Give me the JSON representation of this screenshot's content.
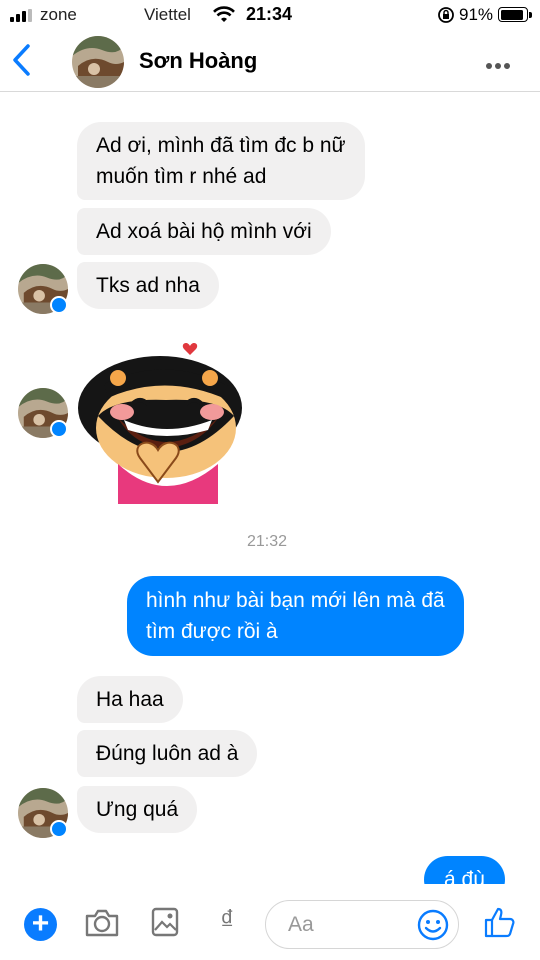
{
  "status_bar": {
    "carrier_left": "zone",
    "carrier": "Viettel",
    "time": "21:34",
    "battery": "91%",
    "battery_level": 0.91
  },
  "header": {
    "contact_name": "Sơn Hoàng",
    "back_icon": "chevron-left-icon",
    "more_icon": "more-icon"
  },
  "messages": {
    "in1": [
      "Ad ơi, mình đã tìm đc b nữ",
      "muốn tìm r nhé ad"
    ],
    "in2": "Ad xoá bài hộ mình với",
    "in3": "Tks ad nha",
    "timestamp": "21:32",
    "out1": [
      "hình như bài bạn mới lên mà đã",
      "tìm được rồi à"
    ],
    "in4": "Ha haa",
    "in5": "Đúng luôn ad à",
    "in6": "Ưng quá",
    "out2": "á đù"
  },
  "composer": {
    "placeholder": "Aa",
    "currency_symbol": "₫",
    "icons": [
      "plus-icon",
      "camera-icon",
      "image-icon",
      "emoji-icon",
      "like-icon"
    ]
  },
  "colors": {
    "accent": "#0084ff",
    "incoming_bubble": "#f1f0f0"
  }
}
